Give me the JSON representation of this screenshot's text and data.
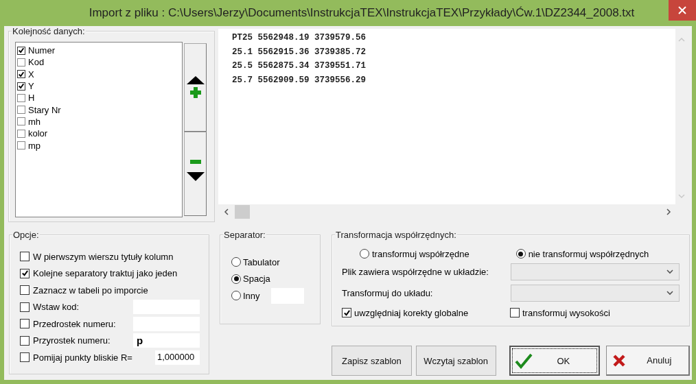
{
  "window": {
    "title": "Import z pliku : C:\\Users\\Jerzy\\Documents\\InstrukcjaTEX\\InstrukcjaTEX\\Przykłady\\Ćw.1\\DZ2344_2008.txt"
  },
  "data_order": {
    "title": "Kolejność danych:",
    "items": [
      {
        "label": "Numer",
        "checked": true
      },
      {
        "label": "Kod",
        "checked": false
      },
      {
        "label": "X",
        "checked": true
      },
      {
        "label": "Y",
        "checked": true
      },
      {
        "label": "H",
        "checked": false
      },
      {
        "label": "Stary Nr",
        "checked": false
      },
      {
        "label": "mh",
        "checked": false
      },
      {
        "label": "kolor",
        "checked": false
      },
      {
        "label": "mp",
        "checked": false
      }
    ]
  },
  "preview": {
    "lines": [
      "PT25 5562948.19 3739579.56",
      "25.1 5562915.36 3739385.72",
      "25.5 5562875.34 3739551.71",
      "25.7 5562909.59 3739556.29"
    ]
  },
  "options": {
    "title": "Opcje:",
    "items": [
      {
        "kind": "check",
        "label": "W pierwszym wierszu tytuły kolumn",
        "checked": false
      },
      {
        "kind": "check",
        "label": "Kolejne separatory traktuj jako jeden",
        "checked": true
      },
      {
        "kind": "check",
        "label": "Zaznacz w tabeli po imporcie",
        "checked": false
      },
      {
        "kind": "field",
        "label": "Wstaw kod:",
        "checked": false
      },
      {
        "kind": "field",
        "label": "Przedrostek numeru:",
        "checked": false
      },
      {
        "kind": "field",
        "label": "Przyrostek numeru:",
        "checked": false,
        "value": "p"
      },
      {
        "kind": "short",
        "label": "Pomijaj punkty bliskie R=",
        "checked": false,
        "value": "1,000000"
      }
    ]
  },
  "separator": {
    "title": "Separator:",
    "options": [
      {
        "kind": "plain",
        "label": "Tabulator",
        "selected": false
      },
      {
        "kind": "plain",
        "label": "Spacja",
        "selected": true
      },
      {
        "kind": "field",
        "label": "Inny",
        "selected": false
      }
    ]
  },
  "transform": {
    "title": "Transformacja współrzędnych:",
    "modes": [
      {
        "label": "transformuj współrzędne",
        "selected": false
      },
      {
        "label": "nie transformuj współrzędnych",
        "selected": true
      }
    ],
    "selects": [
      {
        "label": "Plik zawiera współrzędne w układzie:",
        "disabled": true
      },
      {
        "label": "Transformuj do układu:",
        "disabled": true
      }
    ],
    "checks": [
      {
        "label": "uwzględniaj korekty globalne",
        "checked": true
      },
      {
        "label": "transformuj wysokości",
        "checked": false
      }
    ]
  },
  "buttons": [
    {
      "kind": "plain",
      "label": "Zapisz szablon",
      "focused": false
    },
    {
      "kind": "plain",
      "label": "Wczytaj szablon",
      "focused": false
    },
    {
      "kind": "ok",
      "label": "OK",
      "focused": true
    },
    {
      "kind": "cancel",
      "label": "Anuluj",
      "focused": false
    }
  ]
}
